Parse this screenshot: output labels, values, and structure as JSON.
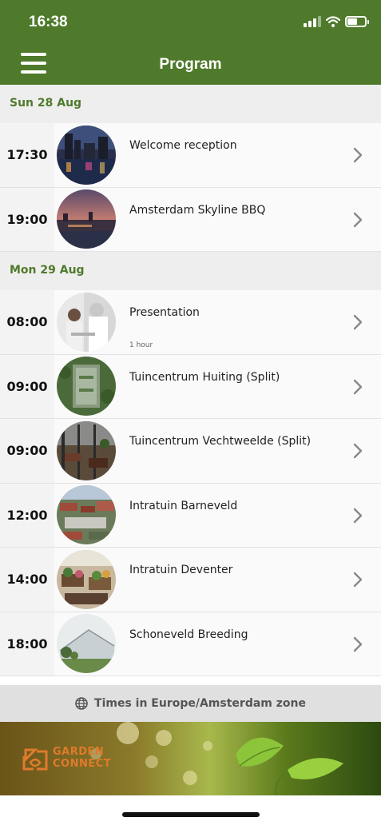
{
  "status_bar": {
    "time": "16:38"
  },
  "header": {
    "title": "Program"
  },
  "days": [
    {
      "label": "Sun 28 Aug",
      "events": [
        {
          "time": "17:30",
          "title": "Welcome reception",
          "subtitle": "",
          "thumb": "city-night-water"
        },
        {
          "time": "19:00",
          "title": "Amsterdam Skyline BBQ",
          "subtitle": "",
          "thumb": "skyline-dusk"
        }
      ]
    },
    {
      "label": "Mon 29 Aug",
      "events": [
        {
          "time": "08:00",
          "title": "Presentation",
          "subtitle": "1 hour",
          "thumb": "people-presentation"
        },
        {
          "time": "09:00",
          "title": "Tuincentrum Huiting (Split)",
          "subtitle": "",
          "thumb": "garden-center-aerial"
        },
        {
          "time": "09:00",
          "title": "Tuincentrum Vechtweelde (Split)",
          "subtitle": "",
          "thumb": "garden-center-interior"
        },
        {
          "time": "12:00",
          "title": "Intratuin Barneveld",
          "subtitle": "",
          "thumb": "town-aerial"
        },
        {
          "time": "14:00",
          "title": "Intratuin Deventer",
          "subtitle": "",
          "thumb": "plant-store"
        },
        {
          "time": "18:00",
          "title": "Schoneveld Breeding",
          "subtitle": "",
          "thumb": "greenhouse"
        }
      ]
    }
  ],
  "timezone_note": "Times in Europe/Amsterdam zone",
  "banner": {
    "logo_line1": "GARDEN",
    "logo_line2": "CONNECT"
  },
  "colors": {
    "brand_green": "#4f7a2b",
    "logo_orange": "#e07a2c"
  }
}
